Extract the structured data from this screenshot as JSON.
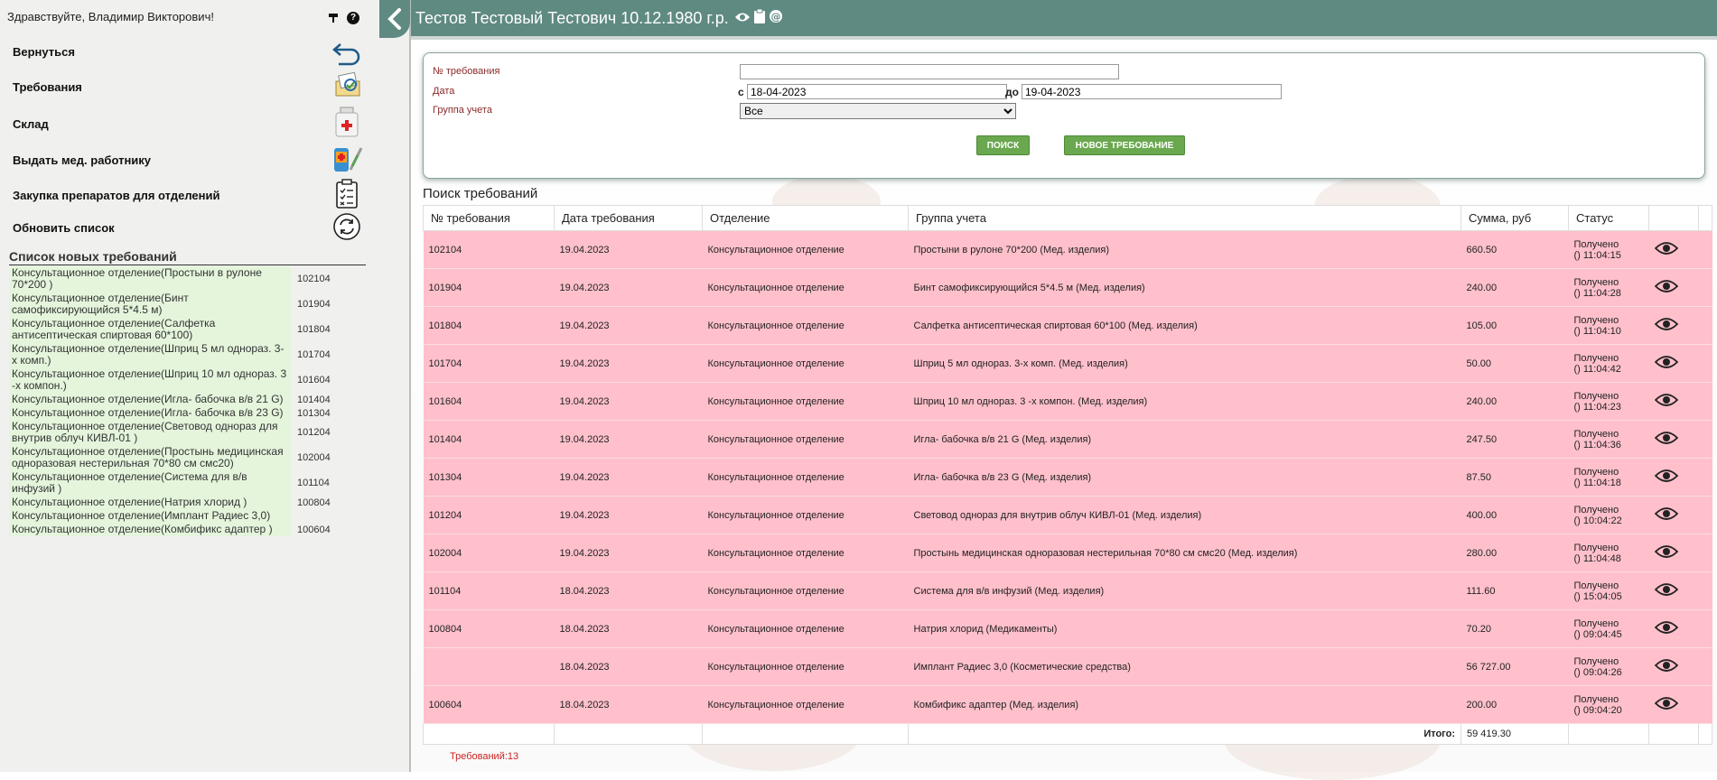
{
  "sidebar": {
    "greeting": "Здравствуйте, Владимир Викторович!",
    "menu": [
      {
        "label": "Вернуться",
        "icon": "return-icon"
      },
      {
        "label": "Требования",
        "icon": "requests-icon"
      },
      {
        "label": "Склад",
        "icon": "warehouse-icon"
      },
      {
        "label": "Выдать мед. работнику",
        "icon": "issue-icon"
      },
      {
        "label": "Закупка препаратов для отделений",
        "icon": "checklist-icon"
      },
      {
        "label": "Обновить список",
        "icon": "refresh-icon"
      }
    ],
    "new_requests_title": "Список новых требований",
    "new_requests": [
      {
        "label": "Консультационное отделение(Простыни в рулоне 70*200 )",
        "num": "102104"
      },
      {
        "label": "Консультационное отделение(Бинт самофиксирующийся 5*4.5 м)",
        "num": "101904"
      },
      {
        "label": "Консультационное отделение(Салфетка антисептическая спиртовая 60*100)",
        "num": "101804"
      },
      {
        "label": "Консультационное отделение(Шприц 5 мл однораз. 3-х комп.)",
        "num": "101704"
      },
      {
        "label": "Консультационное отделение(Шприц 10 мл однораз. 3 -х компон.)",
        "num": "101604"
      },
      {
        "label": "Консультационное отделение(Игла- бабочка в/в 21 G)",
        "num": "101404"
      },
      {
        "label": "Консультационное отделение(Игла- бабочка в/в 23 G)",
        "num": "101304"
      },
      {
        "label": "Консультационное отделение(Световод однораз для внутрив облуч КИВЛ-01 )",
        "num": "101204"
      },
      {
        "label": "Консультационное отделение(Простынь медицинская одноразовая нестерильная 70*80 см смс20)",
        "num": "102004"
      },
      {
        "label": "Консультационное отделение(Система для в/в инфузий )",
        "num": "101104"
      },
      {
        "label": "Консультационное отделение(Натрия хлорид )",
        "num": "100804"
      },
      {
        "label": "Консультационное отделение(Имплант Радиес 3,0)",
        "num": ""
      },
      {
        "label": "Консультационное отделение(Комбификс адаптер )",
        "num": "100604"
      }
    ]
  },
  "header": {
    "title": "Тестов Тестовый Тестович 10.12.1980 г.р."
  },
  "filter": {
    "number_label": "№ требования",
    "number_value": "",
    "date_label": "Дата",
    "from_label": "с",
    "from_value": "18-04-2023",
    "to_label": "до",
    "to_value": "19-04-2023",
    "group_label": "Группа учета",
    "group_value": "Все",
    "search_button": "ПОИСК",
    "new_button": "НОВОЕ ТРЕБОВАНИЕ"
  },
  "results": {
    "title": "Поиск требований",
    "columns": [
      "№ требования",
      "Дата требования",
      "Отделение",
      "Группа учета",
      "Сумма, руб",
      "Статус"
    ],
    "rows": [
      {
        "num": "102104",
        "date": "19.04.2023",
        "dept": "Консультационное отделение",
        "group": "Простыни в рулоне 70*200 (Мед. изделия)",
        "sum": "660.50",
        "status1": "Получено",
        "status2": "() 11:04:15"
      },
      {
        "num": "101904",
        "date": "19.04.2023",
        "dept": "Консультационное отделение",
        "group": "Бинт самофиксирующийся 5*4.5 м (Мед. изделия)",
        "sum": "240.00",
        "status1": "Получено",
        "status2": "() 11:04:28"
      },
      {
        "num": "101804",
        "date": "19.04.2023",
        "dept": "Консультационное отделение",
        "group": "Салфетка антисептическая спиртовая 60*100 (Мед. изделия)",
        "sum": "105.00",
        "status1": "Получено",
        "status2": "() 11:04:10"
      },
      {
        "num": "101704",
        "date": "19.04.2023",
        "dept": "Консультационное отделение",
        "group": "Шприц 5 мл однораз. 3-х комп. (Мед. изделия)",
        "sum": "50.00",
        "status1": "Получено",
        "status2": "() 11:04:42"
      },
      {
        "num": "101604",
        "date": "19.04.2023",
        "dept": "Консультационное отделение",
        "group": "Шприц 10 мл однораз. 3 -х компон. (Мед. изделия)",
        "sum": "240.00",
        "status1": "Получено",
        "status2": "() 11:04:23"
      },
      {
        "num": "101404",
        "date": "19.04.2023",
        "dept": "Консультационное отделение",
        "group": "Игла- бабочка в/в 21 G (Мед. изделия)",
        "sum": "247.50",
        "status1": "Получено",
        "status2": "() 11:04:36"
      },
      {
        "num": "101304",
        "date": "19.04.2023",
        "dept": "Консультационное отделение",
        "group": "Игла- бабочка в/в 23 G (Мед. изделия)",
        "sum": "87.50",
        "status1": "Получено",
        "status2": "() 11:04:18"
      },
      {
        "num": "101204",
        "date": "19.04.2023",
        "dept": "Консультационное отделение",
        "group": "Световод однораз для внутрив облуч КИВЛ-01 (Мед. изделия)",
        "sum": "400.00",
        "status1": "Получено",
        "status2": "() 10:04:22"
      },
      {
        "num": "102004",
        "date": "19.04.2023",
        "dept": "Консультационное отделение",
        "group": "Простынь медицинская одноразовая нестерильная 70*80 см смс20 (Мед. изделия)",
        "sum": "280.00",
        "status1": "Получено",
        "status2": "() 11:04:48"
      },
      {
        "num": "101104",
        "date": "18.04.2023",
        "dept": "Консультационное отделение",
        "group": "Система для в/в инфузий (Мед. изделия)",
        "sum": "111.60",
        "status1": "Получено",
        "status2": "() 15:04:05"
      },
      {
        "num": "100804",
        "date": "18.04.2023",
        "dept": "Консультационное отделение",
        "group": "Натрия хлорид (Медикаменты)",
        "sum": "70.20",
        "status1": "Получено",
        "status2": "() 09:04:45"
      },
      {
        "num": "",
        "date": "18.04.2023",
        "dept": "Консультационное отделение",
        "group": "Имплант Радиес 3,0 (Косметические средства)",
        "sum": "56 727.00",
        "status1": "Получено",
        "status2": "() 09:04:26"
      },
      {
        "num": "100604",
        "date": "18.04.2023",
        "dept": "Консультационное отделение",
        "group": "Комбификс адаптер (Мед. изделия)",
        "sum": "200.00",
        "status1": "Получено",
        "status2": "() 09:04:20"
      }
    ],
    "total_label": "Итого:",
    "total_value": "59 419.30",
    "count_label": "Требований:",
    "count_value": "13"
  },
  "colors": {
    "header": "#5f8a82",
    "row": "#ffc0cb",
    "new_item": "#e4f5dc",
    "button": "#6aa84f",
    "count": "#cc2222"
  }
}
